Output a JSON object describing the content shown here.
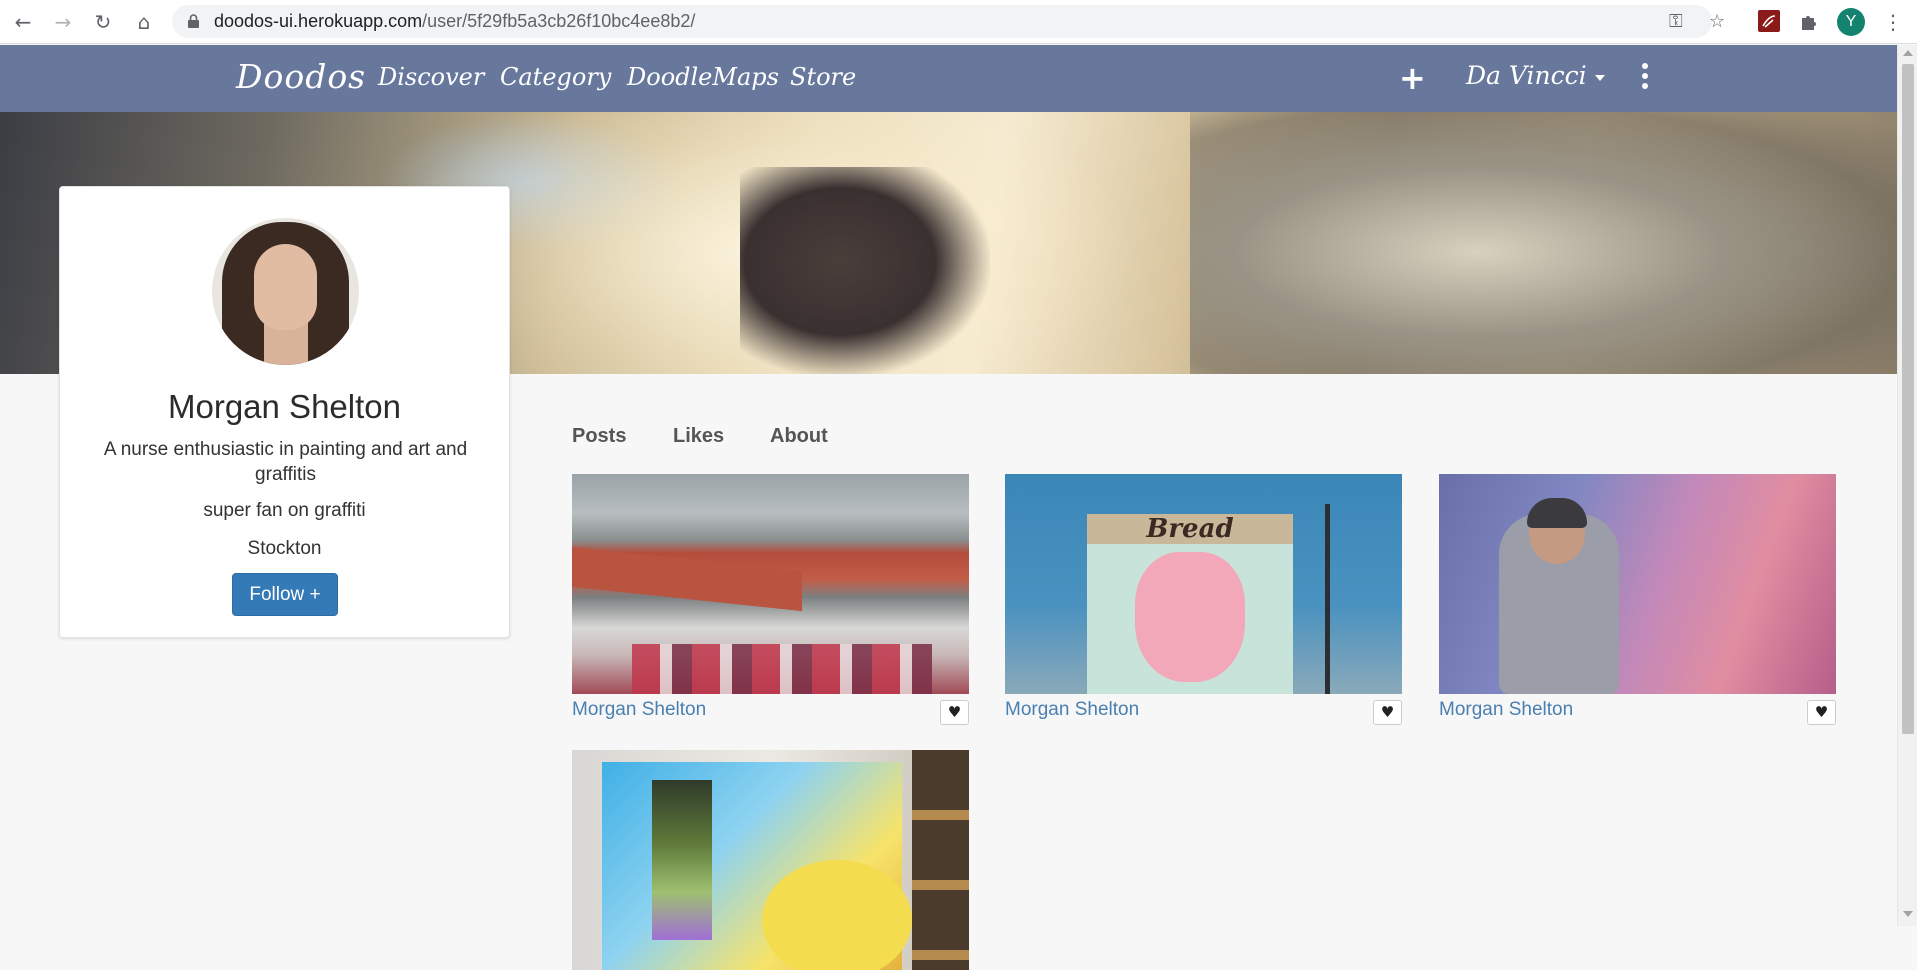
{
  "browser": {
    "url_host": "doodos-ui.herokuapp.com",
    "url_path": "/user/5f29fb5a3cb26f10bc4ee8b2/",
    "profile_initial": "Y"
  },
  "navbar": {
    "brand": "Doodos",
    "links": [
      "Discover",
      "Category",
      "DoodleMaps",
      "Store"
    ],
    "add_icon": "+",
    "user_name": "Da Vincci"
  },
  "profile": {
    "name": "Morgan Shelton",
    "bio": "A nurse enthusiastic in painting and art and graffitis",
    "tagline": "super fan on graffiti",
    "location": "Stockton",
    "follow_label": "Follow +"
  },
  "tabs": [
    "Posts",
    "Likes",
    "About"
  ],
  "posts": [
    {
      "author": "Morgan Shelton",
      "image": "graffiti-train-station"
    },
    {
      "author": "Morgan Shelton",
      "image": "bread-mural"
    },
    {
      "author": "Morgan Shelton",
      "image": "artist-painting-canvas"
    },
    {
      "author": "",
      "image": "colorful-graffiti-canvas"
    }
  ],
  "colors": {
    "navbar_bg": "#68789d",
    "follow_bg": "#337ab7",
    "link_color": "#4a7fb1"
  },
  "icons": {
    "like": "heart-icon",
    "lock": "lock-icon",
    "add": "plus-icon",
    "more": "kebab-menu-icon"
  }
}
